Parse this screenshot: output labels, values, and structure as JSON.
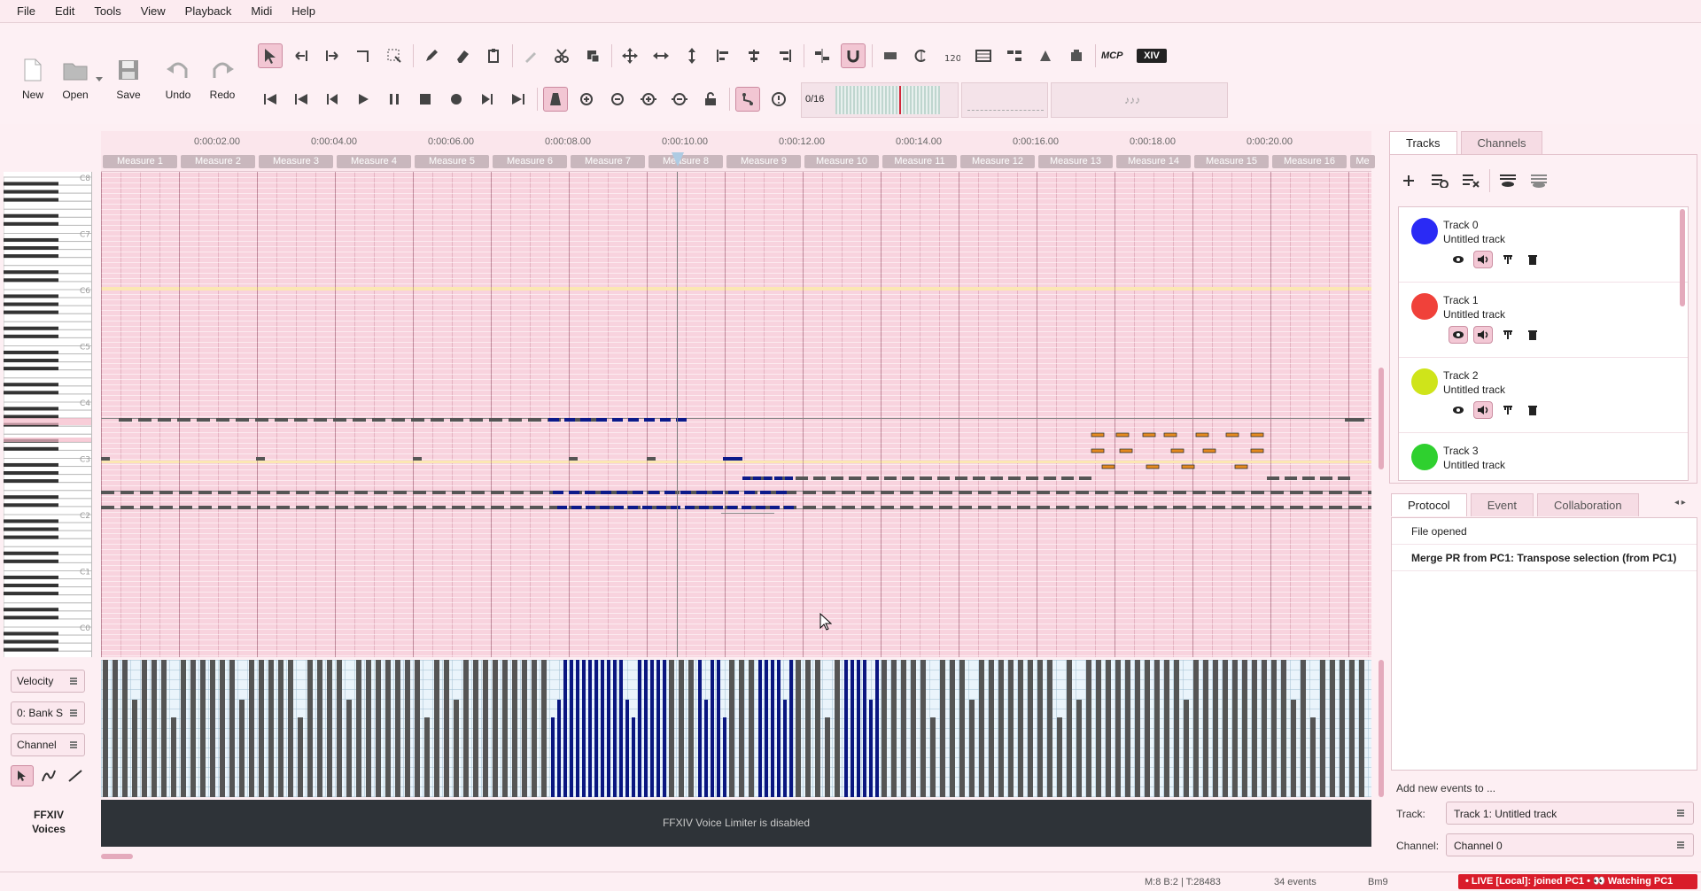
{
  "menu": [
    "File",
    "Edit",
    "Tools",
    "View",
    "Playback",
    "Midi",
    "Help"
  ],
  "toolbar": {
    "new_label": "New",
    "open_label": "Open",
    "save_label": "Save",
    "undo_label": "Undo",
    "redo_label": "Redo",
    "mcp_label": "MCP",
    "xiv_label": "XIV",
    "metronome_display": "0/16",
    "note_display": "♪♪♪"
  },
  "ruler": {
    "times": [
      "0:00:02.00",
      "0:00:04.00",
      "0:00:06.00",
      "0:00:08.00",
      "0:00:10.00",
      "0:00:12.00",
      "0:00:14.00",
      "0:00:16.00",
      "0:00:18.00",
      "0:00:20.00"
    ],
    "measures": [
      "Measure 1",
      "Measure 2",
      "Measure 3",
      "Measure 4",
      "Measure 5",
      "Measure 6",
      "Measure 7",
      "Measure 8",
      "Measure 9",
      "Measure 10",
      "Measure 11",
      "Measure 12",
      "Measure 13",
      "Measure 14",
      "Measure 15",
      "Measure 16",
      "Me"
    ]
  },
  "keys": {
    "octaves": [
      "C8",
      "C7",
      "C6",
      "C5",
      "C4",
      "C3",
      "C2",
      "C1",
      "C0"
    ]
  },
  "controls": {
    "velocity_label": "Velocity",
    "bank_label": "0: Bank S",
    "channel_label": "Channel"
  },
  "voices": {
    "label_line1": "FFXIV",
    "label_line2": "Voices",
    "message": "FFXIV Voice Limiter is disabled"
  },
  "panel": {
    "tabs": [
      "Tracks",
      "Channels"
    ],
    "tracks": [
      {
        "name": "Track 0",
        "sub": "Untitled track",
        "color": "#2a2af5"
      },
      {
        "name": "Track 1",
        "sub": "Untitled track",
        "color": "#f0413a"
      },
      {
        "name": "Track 2",
        "sub": "Untitled track",
        "color": "#cfe41a"
      },
      {
        "name": "Track 3",
        "sub": "Untitled track",
        "color": "#2fd02f"
      }
    ]
  },
  "protocol": {
    "tabs": [
      "Protocol",
      "Event",
      "Collaboration"
    ],
    "entries": [
      "File opened",
      "Merge PR from PC1: Transpose selection (from PC1)"
    ]
  },
  "addnew": {
    "title": "Add new events to ...",
    "track_label": "Track:",
    "track_value": "Track 1: Untitled track",
    "channel_label": "Channel:",
    "channel_value": "Channel 0"
  },
  "status": {
    "position": "M:8 B:2 | T:28483",
    "events": "34 events",
    "chord": "Bm9",
    "live": "• LIVE [Local]: joined PC1 • 👀 Watching PC1"
  }
}
